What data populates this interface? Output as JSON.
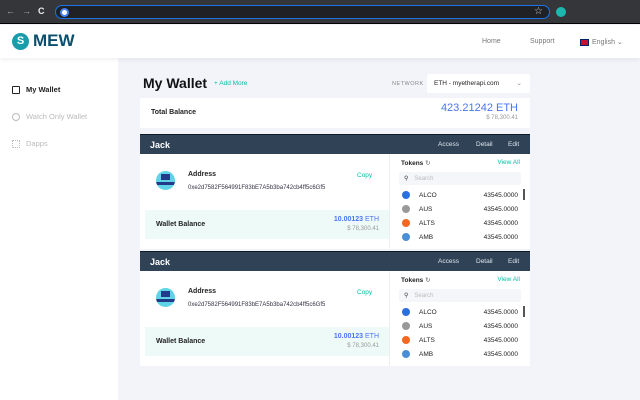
{
  "browser": {
    "back": "←",
    "forward": "→",
    "reload": "C",
    "star": "☆"
  },
  "header": {
    "logo": "MEW",
    "logo_mark": "S",
    "home": "Home",
    "support": "Support",
    "language": "English",
    "lang_chev": "⌄"
  },
  "sidebar": {
    "items": [
      {
        "label": "My Wallet"
      },
      {
        "label": "Watch Only Wallet"
      },
      {
        "label": "Dapps"
      }
    ]
  },
  "main": {
    "title": "My Wallet",
    "add_more": "+ Add More",
    "network_label": "NETWORK",
    "network_value": "ETH - myetherapi.com",
    "network_chev": "⌄",
    "total": {
      "label": "Total Balance",
      "eth": "423.21242 ETH",
      "usd": "$ 78,300.41"
    }
  },
  "wallets": [
    {
      "name": "Jack",
      "access": "Access",
      "detail": "Detail",
      "edit": "Edit",
      "address_label": "Address",
      "address": "0xe2d7582F564991F83bE7A5b3ba742cb4ff5c6Gf5",
      "copy": "Copy",
      "balance_label": "Wallet Balance",
      "balance_num": "10.00123",
      "balance_unit": "ETH",
      "balance_usd": "$ 78,300.41",
      "tokens_label": "Tokens",
      "refresh": "↻",
      "view_all": "View All",
      "search_placeholder": "Search",
      "search_icon": "⚲",
      "tokens": [
        {
          "name": "ALCO",
          "value": "43545.0000"
        },
        {
          "name": "AUS",
          "value": "43545.0000"
        },
        {
          "name": "ALTS",
          "value": "43545.0000"
        },
        {
          "name": "AMB",
          "value": "43545.0000"
        }
      ]
    },
    {
      "name": "Jack",
      "access": "Access",
      "detail": "Detail",
      "edit": "Edit",
      "address_label": "Address",
      "address": "0xe2d7582F564991F83bE7A5b3ba742cb4ff5c6Gf5",
      "copy": "Copy",
      "balance_label": "Wallet Balance",
      "balance_num": "10.00123",
      "balance_unit": "ETH",
      "balance_usd": "$ 78,300.41",
      "tokens_label": "Tokens",
      "refresh": "↻",
      "view_all": "View All",
      "search_placeholder": "Search",
      "search_icon": "⚲",
      "tokens": [
        {
          "name": "ALCO",
          "value": "43545.0000"
        },
        {
          "name": "AUS",
          "value": "43545.0000"
        },
        {
          "name": "ALTS",
          "value": "43545.0000"
        },
        {
          "name": "AMB",
          "value": "43545.0000"
        }
      ]
    }
  ],
  "colors": {
    "accent": "#05c0a5",
    "eth": "#4a74f5",
    "wallet_header": "#2f4256",
    "token_icons": [
      "#2a6fdb",
      "#999999",
      "#f26822",
      "#4a8fd6"
    ]
  }
}
